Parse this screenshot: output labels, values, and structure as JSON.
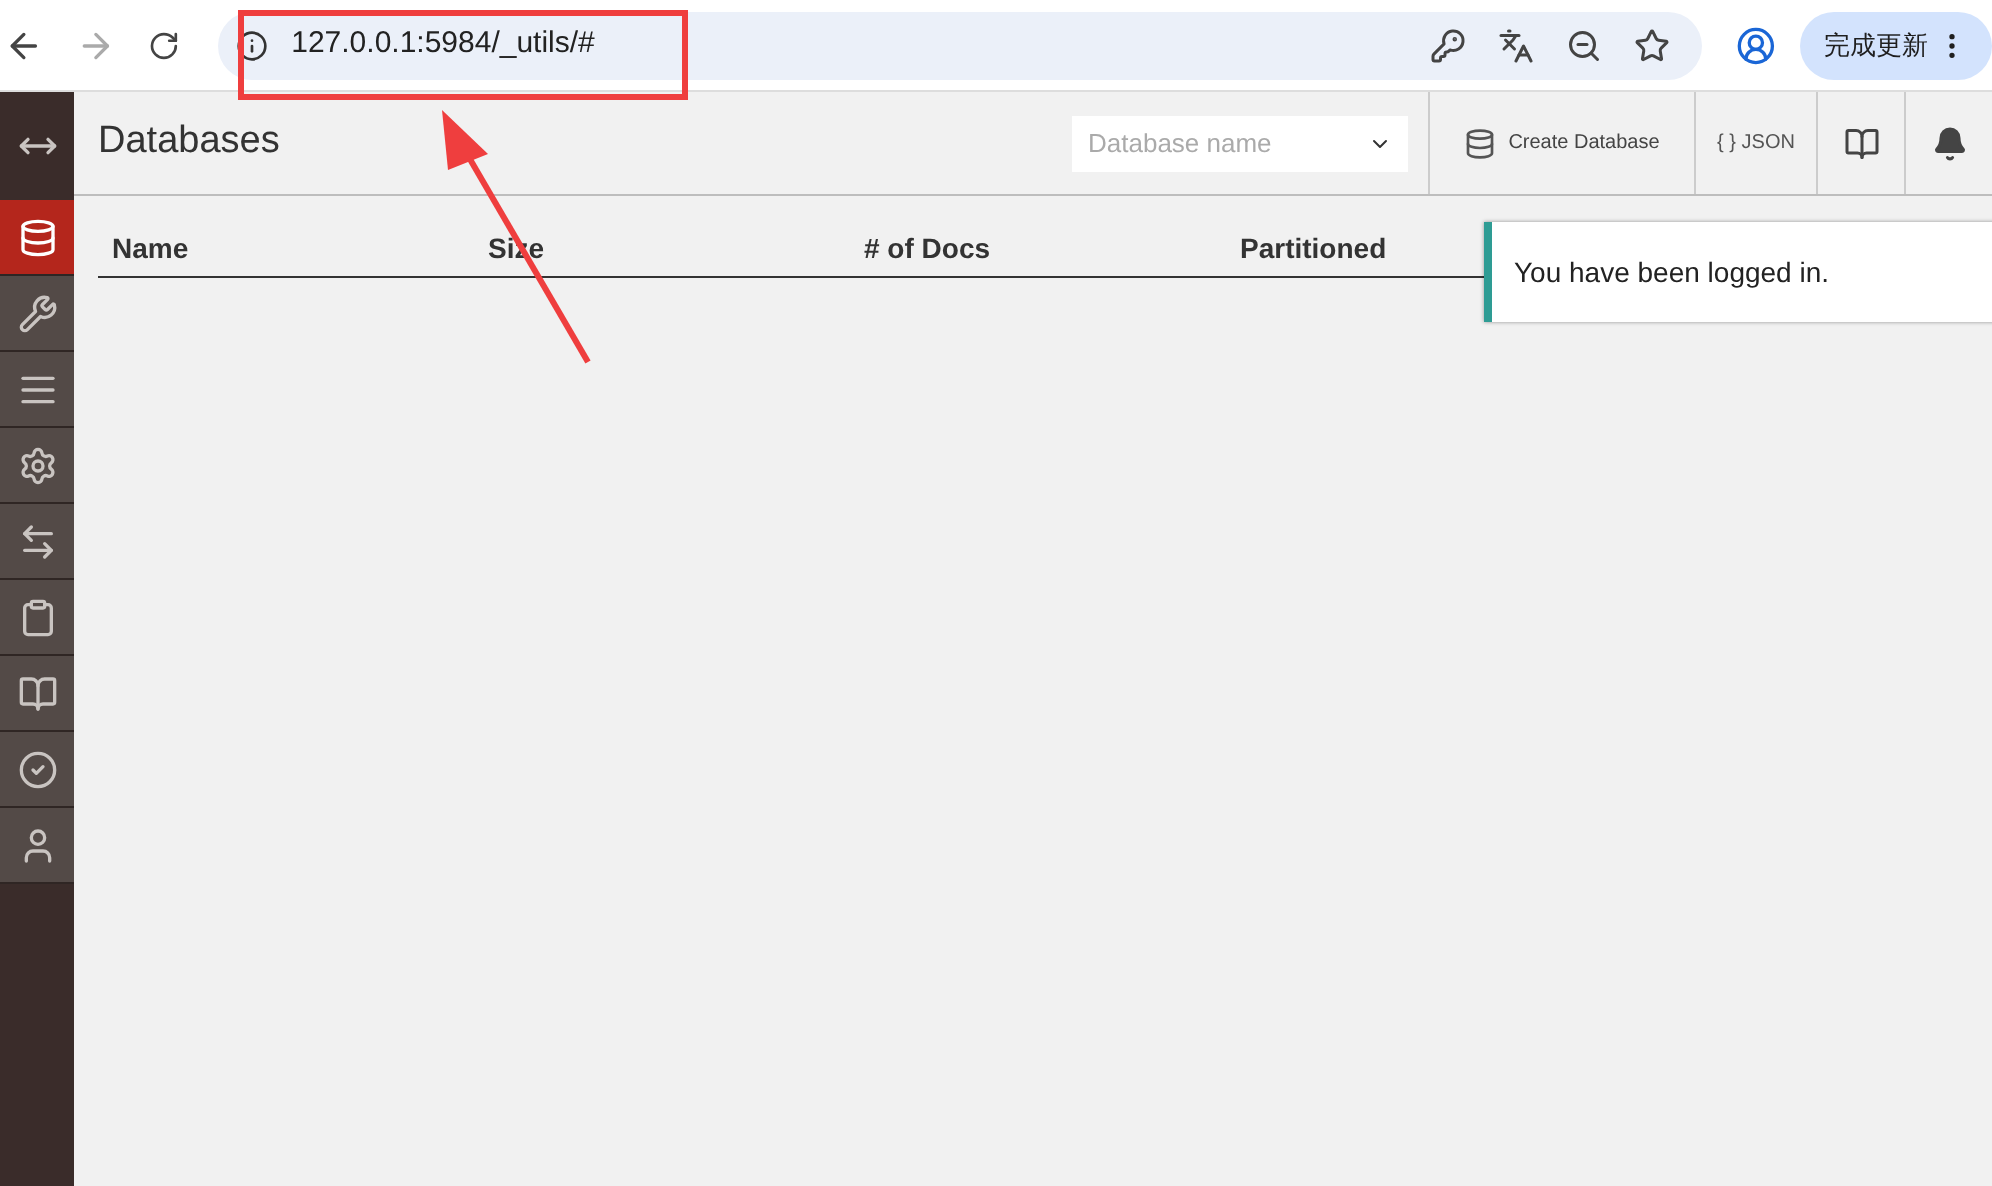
{
  "browser": {
    "url": "127.0.0.1:5984/_utils/#",
    "update_button": "完成更新"
  },
  "sidebar": {
    "items": [
      {
        "kind": "toggle",
        "selected": false
      },
      {
        "kind": "databases",
        "selected": true
      },
      {
        "kind": "setup",
        "selected": false
      },
      {
        "kind": "active-tasks",
        "selected": false
      },
      {
        "kind": "config",
        "selected": false
      },
      {
        "kind": "replication",
        "selected": false
      },
      {
        "kind": "documentation",
        "selected": false
      },
      {
        "kind": "docs-book",
        "selected": false
      },
      {
        "kind": "verify",
        "selected": false
      },
      {
        "kind": "user",
        "selected": false
      }
    ]
  },
  "header": {
    "title": "Databases",
    "search": {
      "placeholder": "Database name"
    },
    "create_button": "Create Database",
    "json_button": "{ } JSON"
  },
  "table": {
    "columns": [
      "Name",
      "Size",
      "# of Docs",
      "Partitioned"
    ]
  },
  "toast": {
    "message": "You have been logged in."
  }
}
